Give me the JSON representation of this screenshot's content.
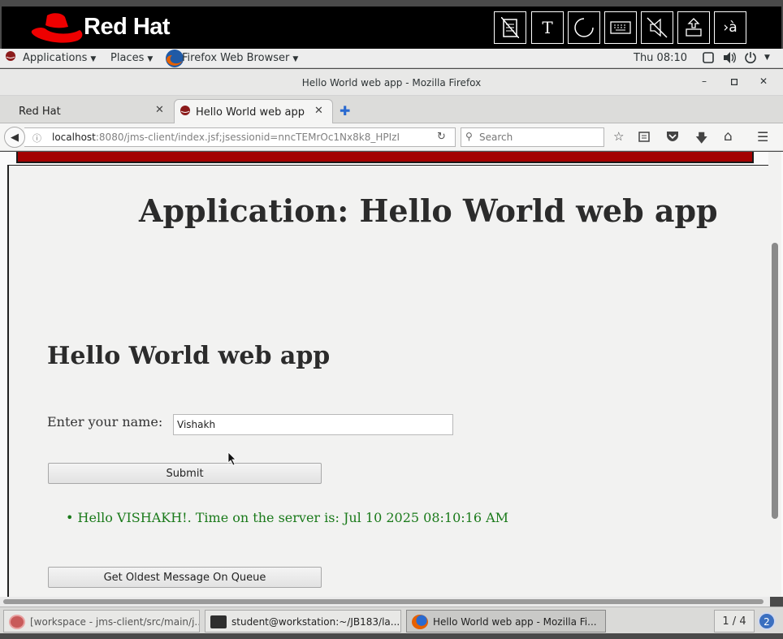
{
  "brand": {
    "name": "Red Hat",
    "toolbar": [
      {
        "icon": "clipboard-icon",
        "glyph": ""
      },
      {
        "icon": "text-tool-icon",
        "glyph": "T"
      },
      {
        "icon": "refresh-circle-icon",
        "glyph": ""
      },
      {
        "icon": "keyboard-icon",
        "glyph": ""
      },
      {
        "icon": "mute-speaker-icon",
        "glyph": ""
      },
      {
        "icon": "eject-icon",
        "glyph": ""
      },
      {
        "icon": "input-method-icon",
        "glyph": "›à"
      }
    ]
  },
  "panel": {
    "applications": "Applications",
    "places": "Places",
    "browser": "Firefox Web Browser",
    "clock": "Thu 08:10"
  },
  "window": {
    "title": "Hello World web app - Mozilla Firefox"
  },
  "tabs": [
    {
      "label": "Red Hat",
      "active": false
    },
    {
      "label": "Hello World web app",
      "active": true
    }
  ],
  "navbar": {
    "url_host": "localhost",
    "url_rest": ":8080/jms-client/index.jsf;jsessionid=nncTEMrOc1Nx8k8_HPIzI",
    "search_placeholder": "Search"
  },
  "page": {
    "app_heading": "Application: Hello World web app",
    "sub_heading": "Hello World web app",
    "name_label": "Enter your name:",
    "name_value": "Vishakh",
    "submit_label": "Submit",
    "message": "Hello VISHAKH!. Time on the server is: Jul 10 2025 08:10:16 AM",
    "oldest_label": "Get Oldest Message On Queue"
  },
  "taskbar": {
    "items": [
      {
        "label": "[workspace - jms-client/src/main/j...",
        "active": false
      },
      {
        "label": "student@workstation:~/JB183/la...",
        "active": false
      },
      {
        "label": "Hello World web app - Mozilla Fi...",
        "active": true
      }
    ],
    "pager": "1 / 4",
    "notifications": "2"
  },
  "colors": {
    "brand_red": "#ee0000",
    "banner_red": "#a30000",
    "message_green": "#1a7a1a"
  }
}
